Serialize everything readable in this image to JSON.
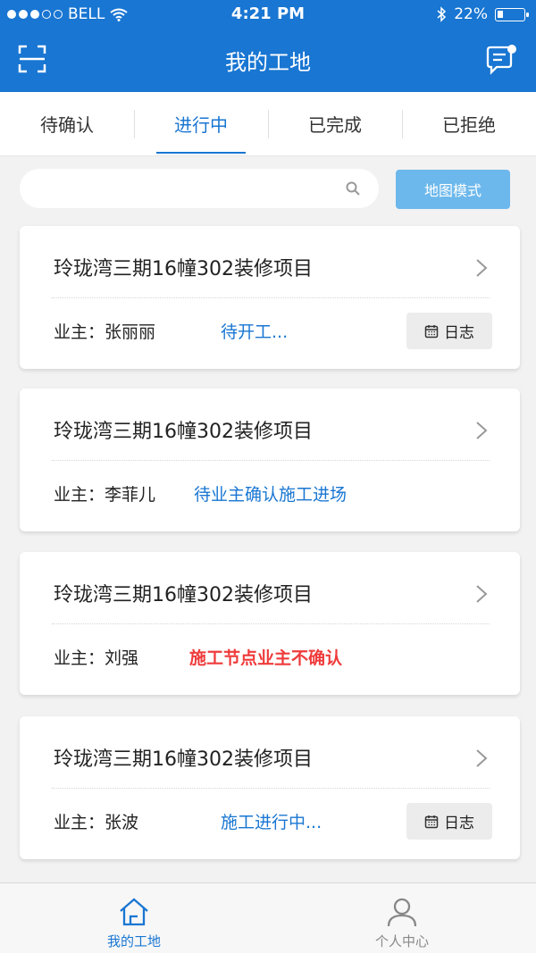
{
  "status_bar": {
    "carrier": "BELL",
    "time": "4:21 PM",
    "battery": "22%",
    "battery_level": 0.22
  },
  "header": {
    "title": "我的工地"
  },
  "tabs": [
    {
      "label": "待确认"
    },
    {
      "label": "进行中"
    },
    {
      "label": "已完成"
    },
    {
      "label": "已拒绝"
    }
  ],
  "active_tab": "进行中",
  "search": {
    "placeholder": "",
    "map_button": "地图模式"
  },
  "projects": [
    {
      "title": "玲珑湾三期16幢302装修项目",
      "owner": "业主：张丽丽",
      "status": "待开工...",
      "log_label": "日志"
    },
    {
      "title": "玲珑湾三期16幢302装修项目",
      "owner": "业主：李菲儿",
      "status": "待业主确认施工进场"
    },
    {
      "title": "玲珑湾三期16幢302装修项目",
      "owner": "业主：刘强",
      "status": "施工节点业主不确认"
    },
    {
      "title": "玲珑湾三期16幢302装修项目",
      "owner": "业主：张波",
      "status": "施工进行中...",
      "log_label": "日志"
    }
  ],
  "bottom_nav": [
    {
      "label": "我的工地"
    },
    {
      "label": "个人中心"
    }
  ],
  "colors": {
    "brand": "#1976d2",
    "status_link": "#1976d2",
    "status_alert": "#ef3b3b",
    "map_button": "#6cb8ec"
  }
}
